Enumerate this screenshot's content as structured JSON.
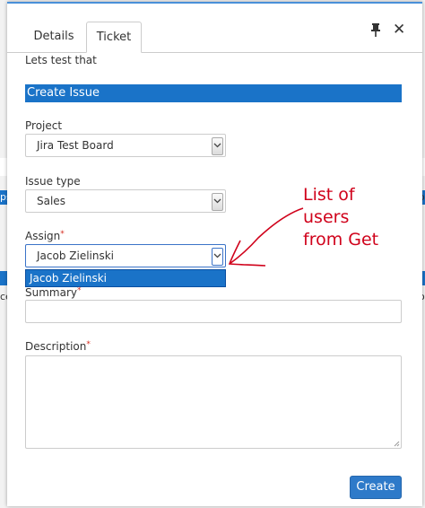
{
  "background": {
    "left_glyphs": [
      "ps",
      "ce"
    ],
    "right_glyphs": [
      "o",
      "o"
    ]
  },
  "tabs": [
    {
      "label": "Details",
      "active": false
    },
    {
      "label": "Ticket",
      "active": true
    }
  ],
  "header_icons": [
    "pin-icon",
    "close-icon"
  ],
  "intro_text": "Lets test that",
  "section_title": "Create Issue",
  "form": {
    "project": {
      "label": "Project",
      "value": "Jira Test Board"
    },
    "issue_type": {
      "label": "Issue type",
      "value": "Sales"
    },
    "assign": {
      "label": "Assign",
      "required_mark": "*",
      "value": "Jacob Zielinski",
      "options": [
        "Jacob Zielinski"
      ]
    },
    "summary": {
      "label": "Summary",
      "required_mark": "*",
      "value": ""
    },
    "description": {
      "label": "Description",
      "required_mark": "*",
      "value": ""
    }
  },
  "create_label": "Create",
  "annotation": {
    "lines": [
      "List of",
      "users",
      "from Get"
    ],
    "color": "#d0021b"
  },
  "colors": {
    "accent": "#1a73c8",
    "button": "#2e7ac9",
    "required": "#d62d20"
  }
}
